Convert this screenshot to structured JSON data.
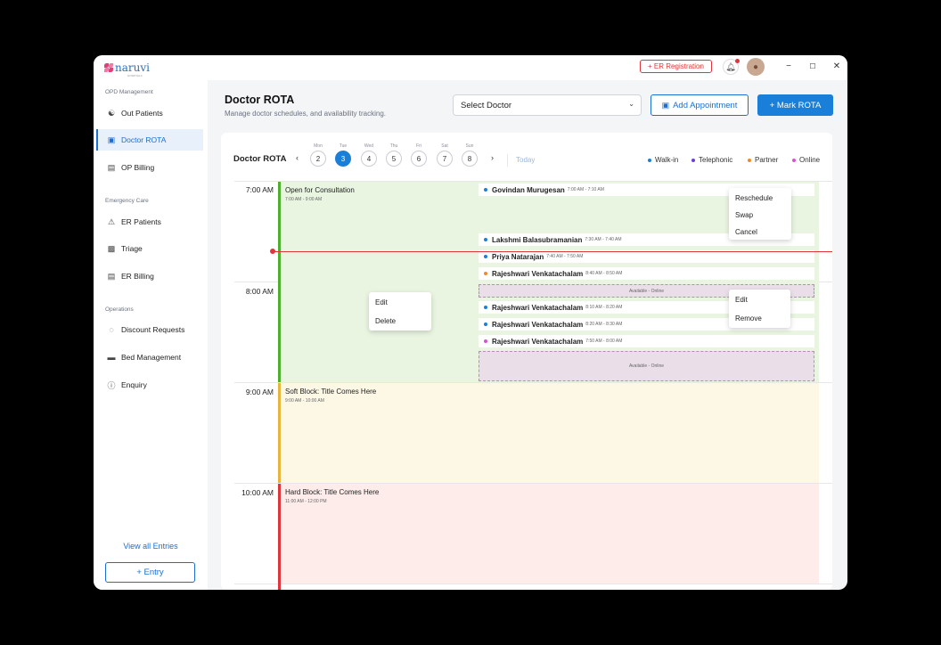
{
  "app": {
    "logo_text": "naruvi",
    "logo_subtext": "HOSPITALS",
    "er_registration_label": "+ ER Registration",
    "window_controls": [
      "−",
      "☐",
      "✕"
    ]
  },
  "sidebar": {
    "sections": [
      {
        "label": "OPD Management"
      },
      {
        "label": "Emergency Care"
      },
      {
        "label": "Operations"
      }
    ],
    "items": [
      {
        "label": "Out Patients",
        "icon": "user-icon"
      },
      {
        "label": "Doctor ROTA",
        "icon": "briefcase-icon",
        "active": true
      },
      {
        "label": "OP Billing",
        "icon": "bill-icon"
      },
      {
        "label": "ER Patients",
        "icon": "emergency-icon"
      },
      {
        "label": "Triage",
        "icon": "triage-icon"
      },
      {
        "label": "ER Billing",
        "icon": "bill-icon"
      },
      {
        "label": "Discount Requests",
        "icon": "discount-icon"
      },
      {
        "label": "Bed Management",
        "icon": "bed-icon"
      },
      {
        "label": "Enquiry",
        "icon": "help-icon"
      }
    ],
    "view_all_label": "View all Entries",
    "entry_button_label": "+ Entry"
  },
  "header": {
    "title": "Doctor ROTA",
    "subtitle": "Manage doctor schedules, and availability tracking.",
    "select_doctor_placeholder": "Select Doctor",
    "add_appointment_label": "Add Appointment",
    "mark_rota_label": "+ Mark ROTA"
  },
  "calendar": {
    "title": "Doctor ROTA",
    "days": [
      {
        "name": "Mon",
        "date": "2"
      },
      {
        "name": "Tue",
        "date": "3",
        "selected": true
      },
      {
        "name": "Wed",
        "date": "4"
      },
      {
        "name": "Thu",
        "date": "5"
      },
      {
        "name": "Fri",
        "date": "6"
      },
      {
        "name": "Sat",
        "date": "7"
      },
      {
        "name": "Sun",
        "date": "8"
      }
    ],
    "today_label": "Today",
    "legend": [
      {
        "label": "Walk-in",
        "color": "#1a7fd8"
      },
      {
        "label": "Telephonic",
        "color": "#6b3fd1"
      },
      {
        "label": "Partner",
        "color": "#f08a24"
      },
      {
        "label": "Online",
        "color": "#d94fd6"
      }
    ],
    "times": [
      "7:00 AM",
      "8:00 AM",
      "9:00 AM",
      "10:00 AM"
    ],
    "blocks": {
      "consultation": {
        "title": "Open for Consultation",
        "time": "7:00 AM - 9:00 AM",
        "color": "#4caf2e",
        "bg": "#e9f5e1"
      },
      "soft": {
        "title": "Soft Block: Title Comes Here",
        "time": "9:00 AM - 10:00 AM",
        "color": "#e8b53a",
        "bg": "#fdf8e6"
      },
      "hard": {
        "title": "Hard Block: Title Comes Here",
        "time": "11:00 AM - 12:00 PM",
        "color": "#e0363b",
        "bg": "#fdecea"
      }
    },
    "appointments": [
      {
        "name": "Govindan Murugesan",
        "time": "7:00 AM - 7:10 AM",
        "color": "#1a7fd8"
      },
      {
        "name": "Lakshmi Balasubramanian",
        "time": "7:30 AM - 7:40 AM",
        "color": "#1a7fd8"
      },
      {
        "name": "Priya Natarajan",
        "time": "7:40 AM - 7:50 AM",
        "color": "#1a7fd8"
      },
      {
        "name": "Rajeshwari Venkatachalam",
        "time": "8:40 AM - 8:50 AM",
        "color": "#f08a24"
      },
      {
        "name": "Rajeshwari Venkatachalam",
        "time": "8:10 AM - 8:20 AM",
        "color": "#1a7fd8"
      },
      {
        "name": "Rajeshwari Venkatachalam",
        "time": "8:20 AM - 8:30 AM",
        "color": "#1a7fd8"
      },
      {
        "name": "Rajeshwari Venkatachalam",
        "time": "7:50 AM - 8:00 AM",
        "color": "#d94fd6"
      }
    ],
    "available_label": "Available - Online",
    "menus": {
      "appointment": [
        "Reschedule",
        "Swap",
        "Cancel"
      ],
      "block": [
        "Edit",
        "Delete"
      ],
      "slot": [
        "Edit",
        "Remove"
      ]
    }
  }
}
